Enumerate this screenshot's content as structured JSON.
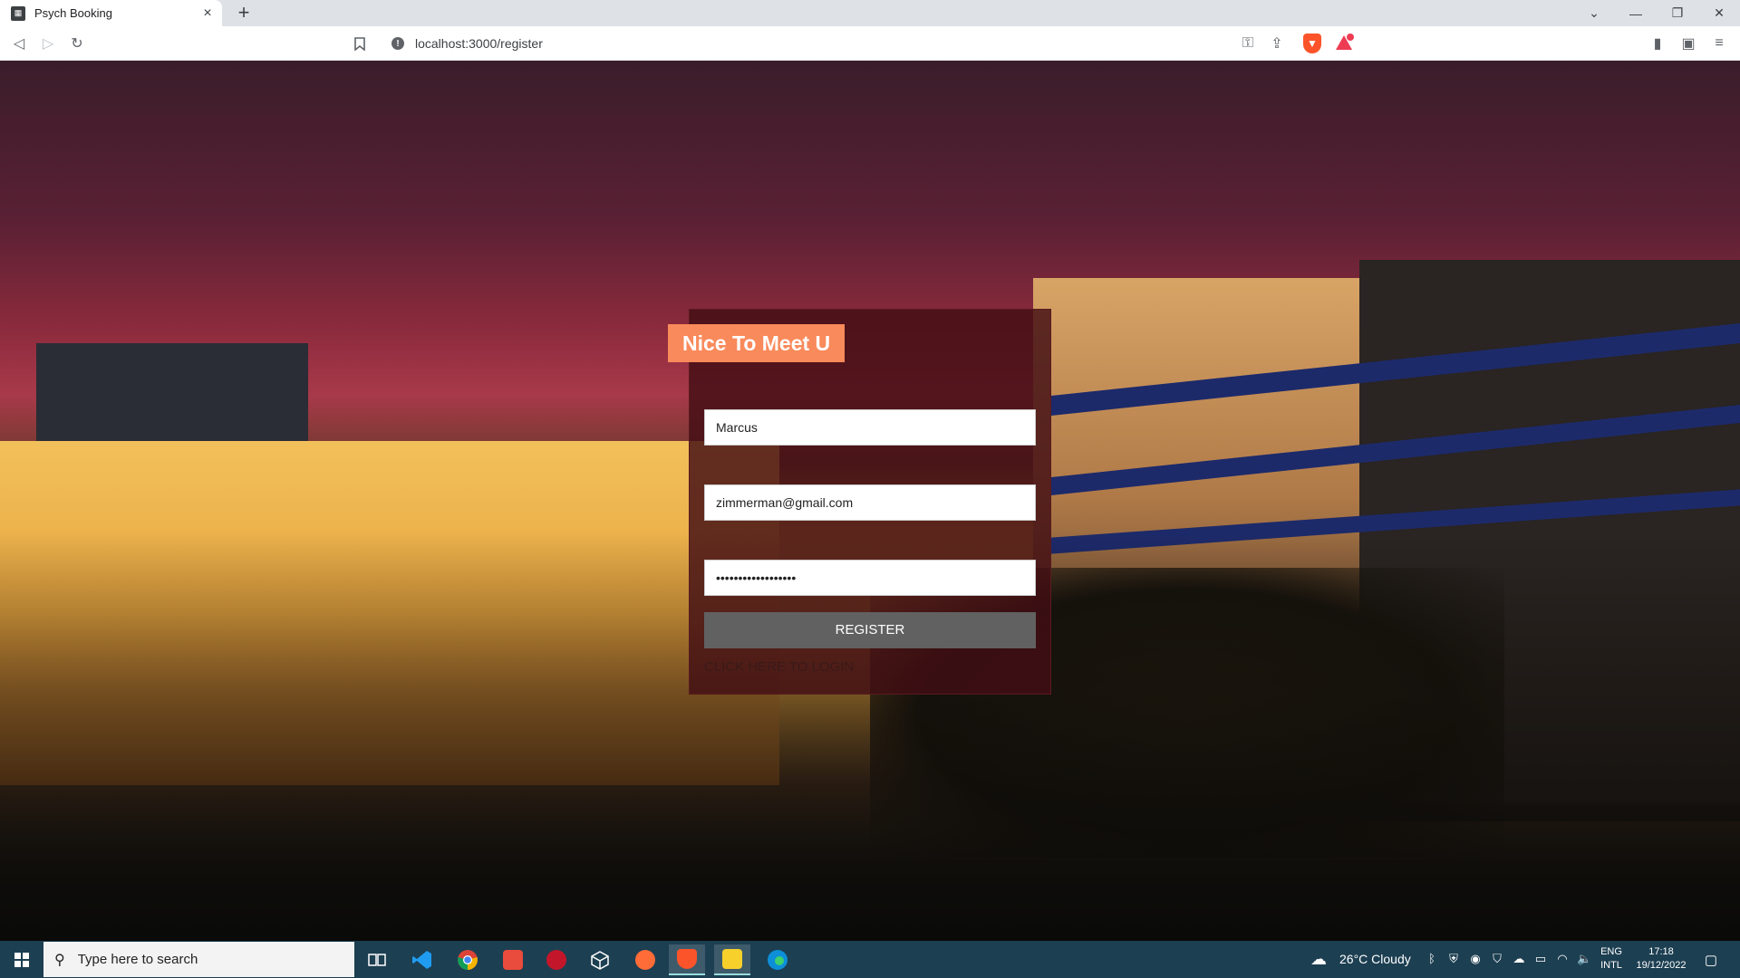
{
  "browser": {
    "tab_title": "Psych Booking",
    "url": "localhost:3000/register",
    "tab_close": "×",
    "new_tab": "+"
  },
  "form": {
    "heading": "Nice To Meet U",
    "name_value": "Marcus",
    "email_value": "zimmerman@gmail.com",
    "password_value": "••••••••••••••••••",
    "register_label": "REGISTER",
    "login_link": "CLICK HERE TO LOGIN"
  },
  "taskbar": {
    "search_placeholder": "Type here to search",
    "weather": "26°C  Cloudy",
    "lang_line1": "ENG",
    "lang_line2": "INTL",
    "time": "17:18",
    "date": "19/12/2022"
  },
  "colors": {
    "heading_bg": "#f98a5b",
    "card_bg": "#420e14",
    "register_bg": "#616161",
    "taskbar_bg": "#1d3f52"
  },
  "icons": {
    "taskbar": [
      "task-view-icon",
      "vscode-icon",
      "chrome-icon",
      "git-icon",
      "red-app-icon",
      "cube-icon",
      "postman-icon",
      "brave-icon",
      "sticky-notes-icon",
      "edge-icon"
    ]
  }
}
